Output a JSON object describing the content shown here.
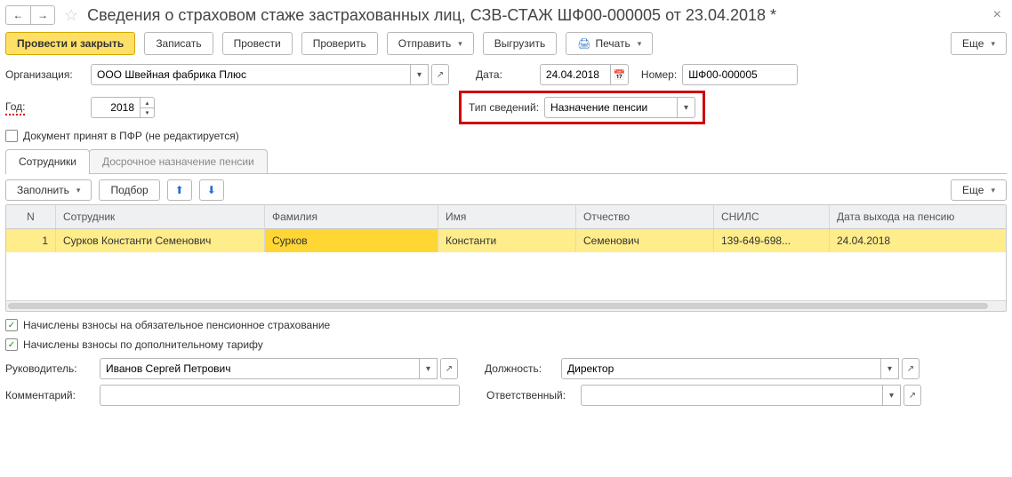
{
  "header": {
    "title": "Сведения о страховом стаже застрахованных лиц, СЗВ-СТАЖ ШФ00-000005 от 23.04.2018 *"
  },
  "toolbar": {
    "post_and_close": "Провести и закрыть",
    "save": "Записать",
    "post": "Провести",
    "check": "Проверить",
    "send": "Отправить",
    "export": "Выгрузить",
    "print": "Печать",
    "more": "Еще"
  },
  "form": {
    "org_label": "Организация:",
    "org_value": "ООО Швейная фабрика Плюс",
    "date_label": "Дата:",
    "date_value": "24.04.2018",
    "number_label": "Номер:",
    "number_value": "ШФ00-000005",
    "year_label": "Год:",
    "year_value": "2018",
    "info_type_label": "Тип сведений:",
    "info_type_value": "Назначение пенсии",
    "accepted_pfr": "Документ принят в ПФР (не редактируется)"
  },
  "tabs": {
    "employees": "Сотрудники",
    "early_pension": "Досрочное назначение пенсии"
  },
  "subtoolbar": {
    "fill": "Заполнить",
    "select": "Подбор",
    "more": "Еще"
  },
  "grid": {
    "headers": {
      "n": "N",
      "employee": "Сотрудник",
      "lastname": "Фамилия",
      "firstname": "Имя",
      "patronymic": "Отчество",
      "snils": "СНИЛС",
      "pension_date": "Дата выхода на пенсию"
    },
    "rows": [
      {
        "n": "1",
        "employee": "Сурков Константи Семенович",
        "lastname": "Сурков",
        "firstname": "Константи",
        "patronymic": "Семенович",
        "snils": "139-649-698...",
        "pension_date": "24.04.2018"
      }
    ]
  },
  "bottom": {
    "ops_charged": "Начислены взносы на обязательное пенсионное страхование",
    "addl_charged": "Начислены взносы по дополнительному тарифу",
    "manager_label": "Руководитель:",
    "manager_value": "Иванов Сергей Петрович",
    "position_label": "Должность:",
    "position_value": "Директор",
    "comment_label": "Комментарий:",
    "responsible_label": "Ответственный:"
  }
}
